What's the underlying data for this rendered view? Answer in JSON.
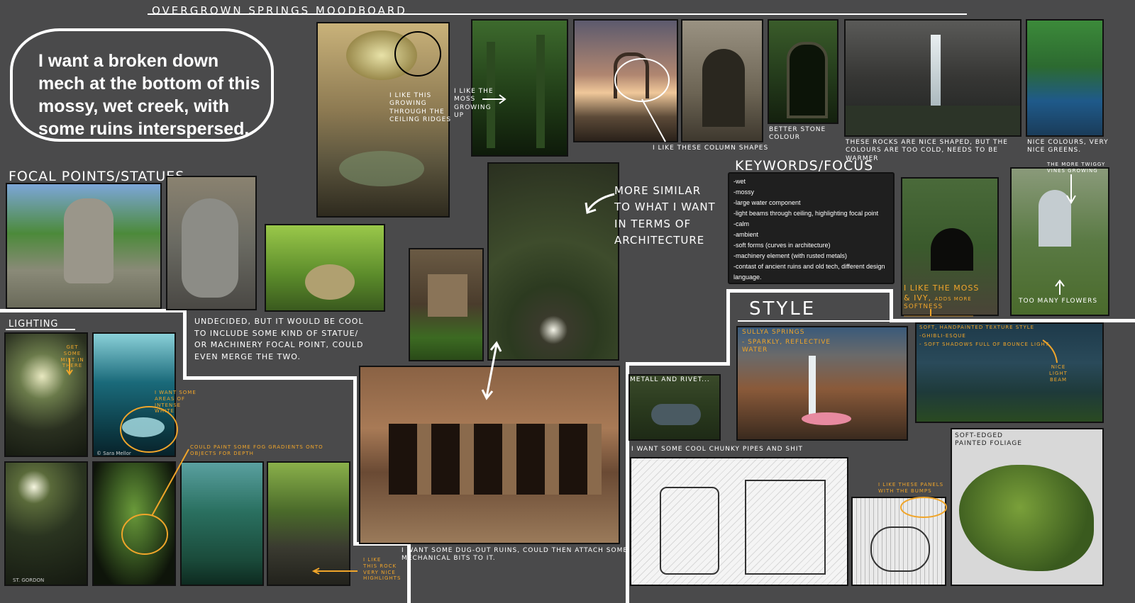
{
  "board": {
    "title": "OVERGROWN SPRINGS MOODBOARD",
    "intro": "I want a broken down mech at the bottom of this mossy, wet creek, with some ruins interspersed."
  },
  "sections": {
    "focal_points": "FOCAL POINTS/STATUES",
    "lighting": "LIGHTING",
    "keywords": "KEYWORDS/FOCUS",
    "style": "STYLE"
  },
  "keywords": [
    "-wet",
    "-mossy",
    "-large water component",
    "-light beams through ceiling, highlighting focal point",
    "-calm",
    "-ambient",
    "-soft forms (curves in architecture)",
    "-machinery element (with rusted metals)",
    "-contast of ancient ruins and old tech, different design language."
  ],
  "notes": {
    "ceiling": "I LIKE THIS GROWING THROUGH THE CEILING RIDGES",
    "moss_up": "I LIKE THE MOSS GROWING UP",
    "columns": "I LIKE THESE COLUMN SHAPES",
    "stone": "BETTER STONE COLOUR",
    "rocks": "THESE ROCKS ARE NICE SHAPED, BUT THE COLOURS ARE TOO COLD, NEEDS TO BE WARMER",
    "greens": "NICE COLOURS, VERY NICE GREENS.",
    "architecture": "MORE SIMILAR TO WHAT I WANT IN TERMS OF ARCHITECTURE",
    "vines": "THE MORE TWIGGY VINES GROWING",
    "flowers": "TOO MANY FLOWERS",
    "moss_ivy_1": "I LIKE THE MOSS",
    "moss_ivy_2": "& IVY,",
    "moss_ivy_3": "ADDS MORE",
    "moss_ivy_4": "SOFTNESS",
    "undecided": "UNDECIDED, BUT IT WOULD BE COOL TO INCLUDE SOME KIND OF STATUE/ OR MACHINERY FOCAL POINT, COULD EVEN MERGE THE TWO.",
    "mist": "GET SOME MIST IN THERE",
    "intense_white": "I WANT SOME AREAS OF INTENSE WHITE",
    "fog": "COULD PAINT SOME FOG GRADIENTS ONTO OBJECTS FOR DEPTH",
    "rock_highlights": "I LIKE THIS ROCK VERY NICE HIGHLIGHTS",
    "dugout": "I WANT SOME DUG-OUT RUINS, COULD THEN ATTACH SOME MECHANICAL BITS TO IT.",
    "metall": "METALL AND RIVET...",
    "pipes": "I WANT SOME COOL CHUNKY PIPES AND SHIT",
    "sullya": "SULLYA SPRINGS",
    "sparkly": "- SPARKLY, REFLECTIVE WATER",
    "handpainted": "SOFT, HANDPAINTED TEXTURE STYLE",
    "ghibli": "-GHIBLI-ESQUE",
    "soft_shadows": "- SOFT SHADOWS FULL OF BOUNCE LIGHT",
    "light_beam": "NICE LIGHT BEAM",
    "panels": "I LIKE THESE PANELS WITH THE BUMPS",
    "soft_edged": "SOFT-EDGED PAINTED FOLIAGE",
    "photo_credit": "© Sara Mellor",
    "photo_credit2": "ST. GORDON"
  },
  "colors": {
    "background": "#4a4a4b",
    "annotation_orange": "#f0a52a",
    "ink_white": "#ffffff"
  }
}
